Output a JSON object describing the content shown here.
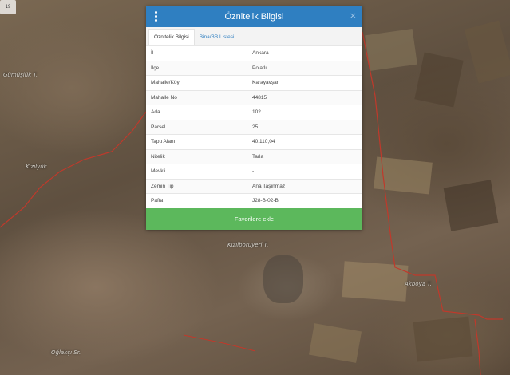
{
  "map": {
    "zoom_label": "19",
    "place_labels": [
      "Gümüşlük T.",
      "Kızılyük",
      "Kızılboruyeri T.",
      "Akboya T.",
      "Oğlakçı Sr."
    ]
  },
  "dialog": {
    "title": "Öznitelik Bilgisi",
    "close_symbol": "×",
    "tabs": [
      {
        "label": "Öznitelik Bilgisi",
        "active": true
      },
      {
        "label": "Bina/BB Listesi",
        "active": false
      }
    ],
    "attributes": [
      {
        "key": "İl",
        "value": "Ankara"
      },
      {
        "key": "İlçe",
        "value": "Polatlı"
      },
      {
        "key": "Mahalle/Köy",
        "value": "Karayavşan"
      },
      {
        "key": "Mahalle No",
        "value": "44815"
      },
      {
        "key": "Ada",
        "value": "102"
      },
      {
        "key": "Parsel",
        "value": "25"
      },
      {
        "key": "Tapu Alanı",
        "value": "40.110,04"
      },
      {
        "key": "Nitelik",
        "value": "Tarla"
      },
      {
        "key": "Mevkii",
        "value": "-"
      },
      {
        "key": "Zemin Tip",
        "value": "Ana Taşınmaz"
      },
      {
        "key": "Pafta",
        "value": "J28-B-02-B"
      }
    ],
    "favorite_button": "Favorilere ekle"
  },
  "colors": {
    "header_blue": "#2f7fc1",
    "button_green": "#5cb85c",
    "parcel_border_red": "#c0392b"
  }
}
